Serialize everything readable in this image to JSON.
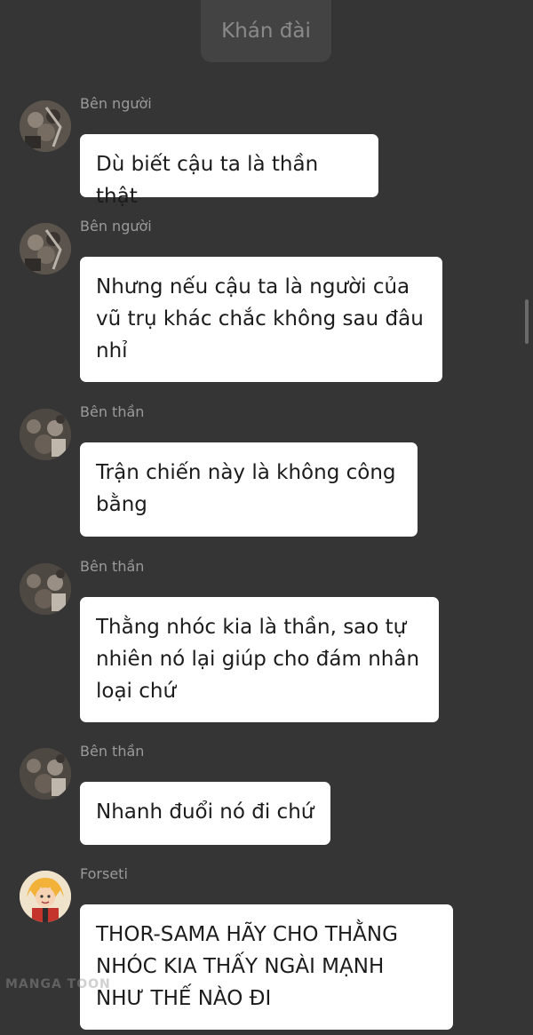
{
  "header": {
    "title": "Khán đài"
  },
  "messages": [
    {
      "sender": "Bên người",
      "avatar": "crowd-avatar",
      "text": "Dù biết cậu ta là thần thật"
    },
    {
      "sender": "Bên người",
      "avatar": "crowd-avatar",
      "text": "Nhưng nếu cậu ta là người của vũ trụ khác chắc không sau đâu nhỉ"
    },
    {
      "sender": "Bên thần",
      "avatar": "crowd-avatar",
      "text": "Trận chiến này là không công bằng"
    },
    {
      "sender": "Bên thần",
      "avatar": "crowd-avatar",
      "text": "Thằng nhóc kia là thần, sao tự nhiên nó lại giúp cho đám nhân loại chứ"
    },
    {
      "sender": "Bên thần",
      "avatar": "crowd-avatar",
      "text": "Nhanh đuổi nó đi chứ"
    },
    {
      "sender": "Forseti",
      "avatar": "character-avatar",
      "text": "THOR-SAMA HÃY CHO THẰNG NHÓC KIA THẤY NGÀI MẠNH NHƯ THẾ NÀO ĐI"
    }
  ],
  "watermark": "MANGA TOON"
}
